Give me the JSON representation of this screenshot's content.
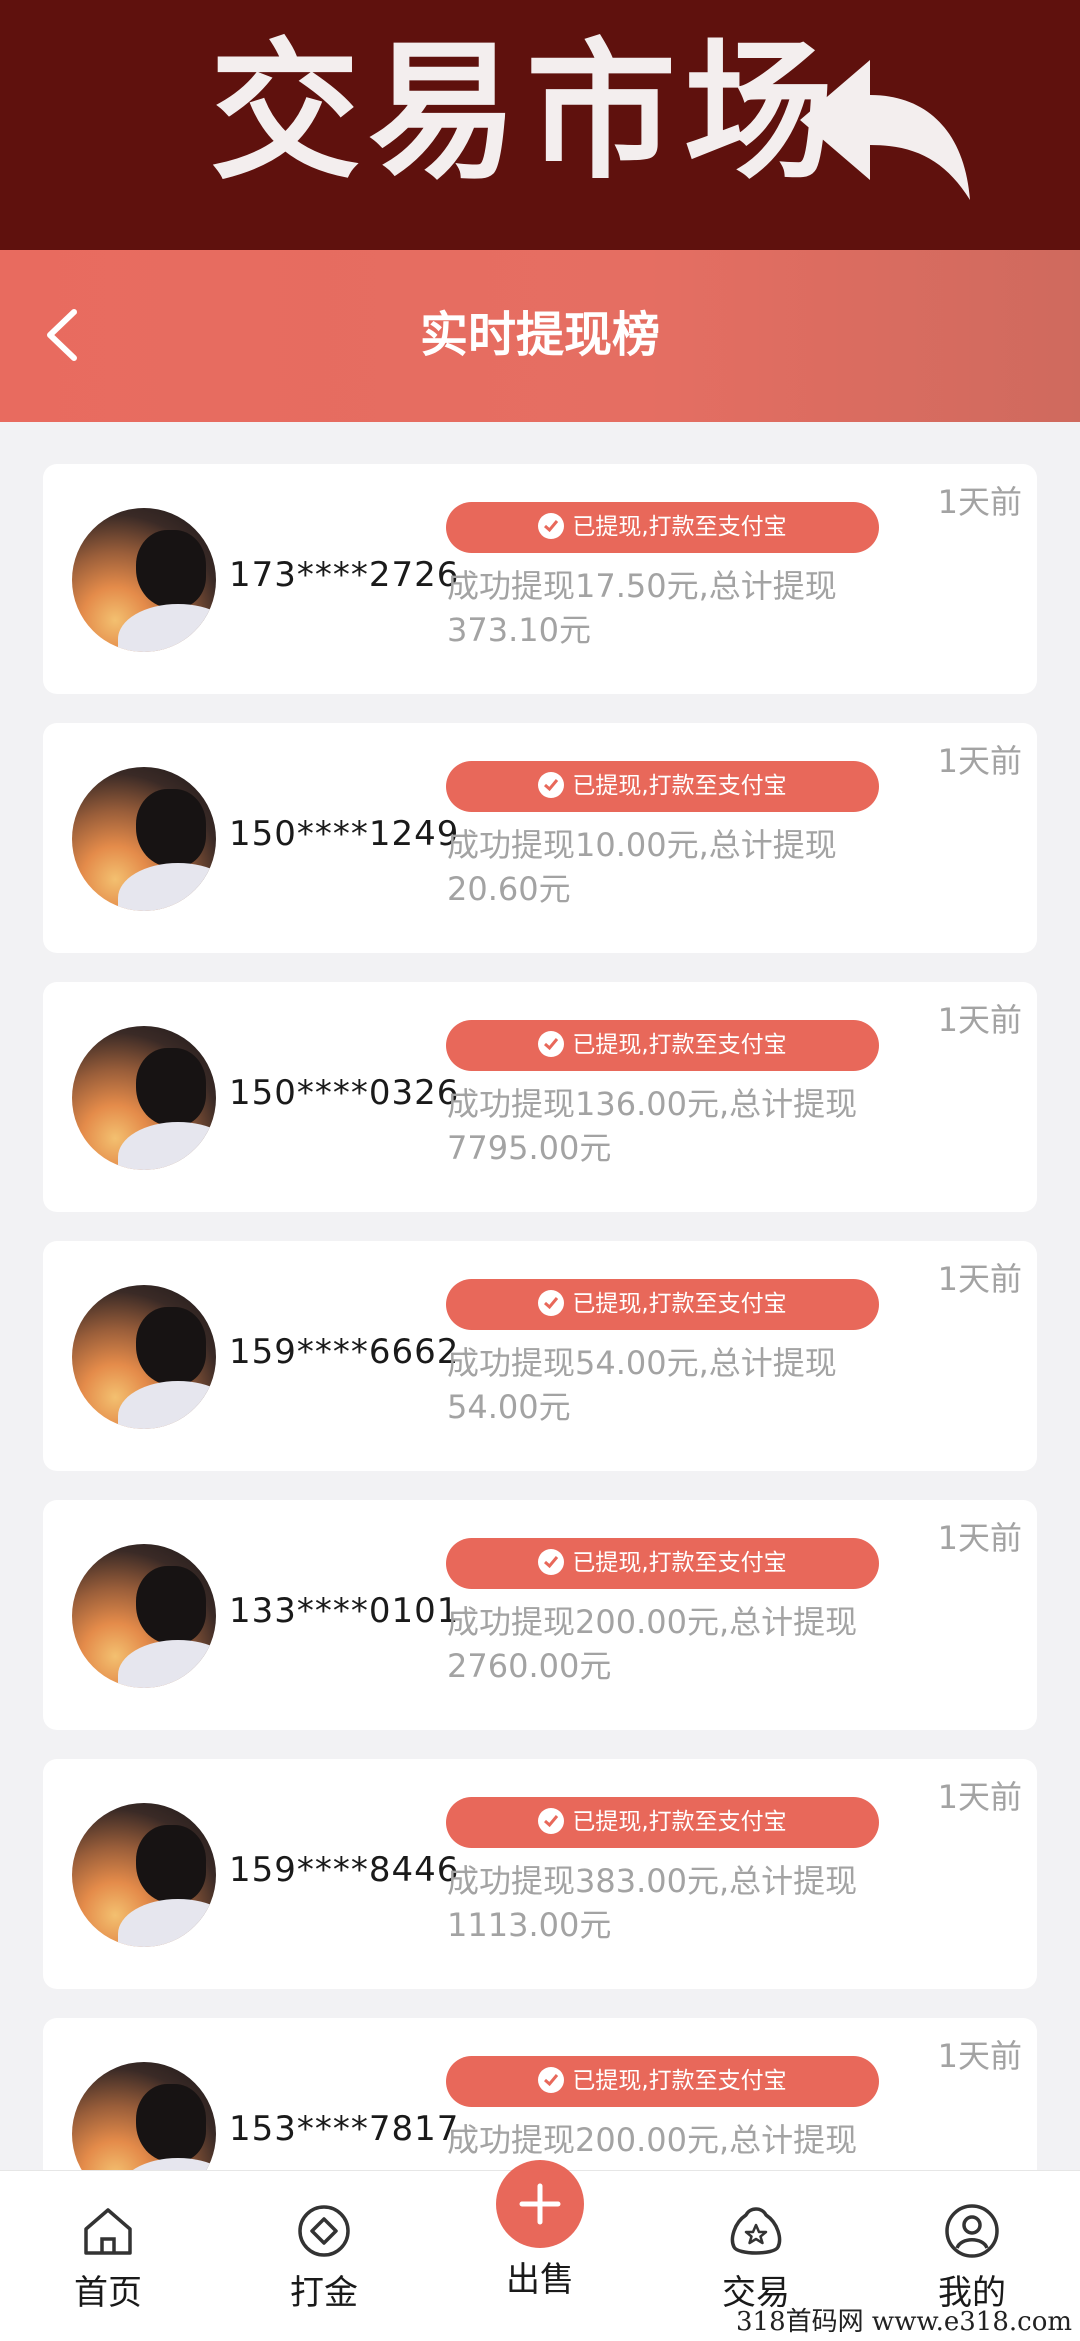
{
  "banner": {
    "title": "交易市场"
  },
  "header": {
    "title": "实时提现榜"
  },
  "records": [
    {
      "phone": "173****2726",
      "badge": "已提现,打款至支付宝",
      "desc": "成功提现17.50元,总计提现373.10元",
      "time": "1天前"
    },
    {
      "phone": "150****1249",
      "badge": "已提现,打款至支付宝",
      "desc": "成功提现10.00元,总计提现20.60元",
      "time": "1天前"
    },
    {
      "phone": "150****0326",
      "badge": "已提现,打款至支付宝",
      "desc": "成功提现136.00元,总计提现7795.00元",
      "time": "1天前"
    },
    {
      "phone": "159****6662",
      "badge": "已提现,打款至支付宝",
      "desc": "成功提现54.00元,总计提现54.00元",
      "time": "1天前"
    },
    {
      "phone": "133****0101",
      "badge": "已提现,打款至支付宝",
      "desc": "成功提现200.00元,总计提现2760.00元",
      "time": "1天前"
    },
    {
      "phone": "159****8446",
      "badge": "已提现,打款至支付宝",
      "desc": "成功提现383.00元,总计提现1113.00元",
      "time": "1天前"
    },
    {
      "phone": "153****7817",
      "badge": "已提现,打款至支付宝",
      "desc": "成功提现200.00元,总计提现",
      "time": "1天前"
    }
  ],
  "tabbar": {
    "home": "首页",
    "dajin": "打金",
    "sell": "出售",
    "trade": "交易",
    "mine": "我的"
  },
  "watermark": "318首码网 www.e318.com",
  "colors": {
    "banner": "#5f110d",
    "accent": "#e8685a",
    "background": "#f2f2f4"
  }
}
